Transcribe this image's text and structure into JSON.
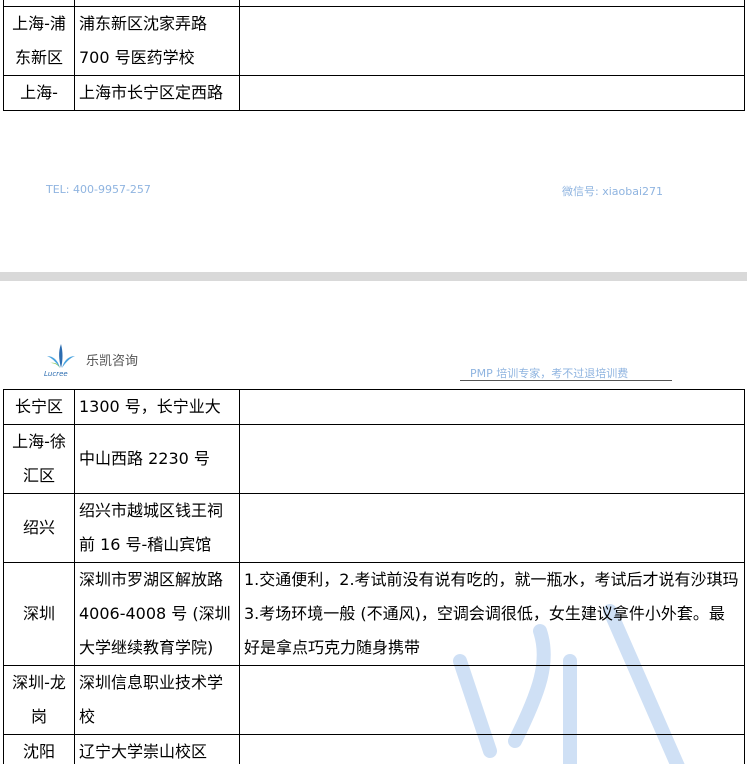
{
  "page1": {
    "rows": [
      {
        "city": "",
        "address": "",
        "note": ""
      },
      {
        "city": "上海-浦东新区",
        "address": "浦东新区沈家弄路 700 号医药学校",
        "note": ""
      },
      {
        "city": "上海-",
        "address": "上海市长宁区定西路",
        "note": ""
      }
    ],
    "footer_tel": "TEL: 400-9957-257",
    "footer_wechat": "微信号: xiaobai271"
  },
  "page2": {
    "logo_text": "Lucree",
    "brand": "乐凯咨询",
    "tagline": "PMP 培训专家，考不过退培训费",
    "rows": [
      {
        "city": "长宁区",
        "address": "1300 号，长宁业大",
        "note": ""
      },
      {
        "city": "上海-徐汇区",
        "address": "中山西路 2230 号",
        "note": ""
      },
      {
        "city": "绍兴",
        "address": "绍兴市越城区钱王祠前 16 号-稽山宾馆",
        "note": ""
      },
      {
        "city": "深圳",
        "address": "深圳市罗湖区解放路 4006-4008 号 (深圳大学继续教育学院)",
        "note": "1.交通便利，2.考试前没有说有吃的，就一瓶水，考试后才说有沙琪玛 3.考场环境一般 (不通风)，空调会调很低，女生建议拿件小外套。最好是拿点巧克力随身携带"
      },
      {
        "city": "深圳-龙岗",
        "address": "深圳信息职业技术学校",
        "note": ""
      },
      {
        "city": "沈阳",
        "address": "辽宁大学崇山校区",
        "note": ""
      }
    ]
  },
  "colors": {
    "footer": "#8fb4e0",
    "logo_blue": "#2b6cb0",
    "watermark": "#cfe0f5"
  }
}
